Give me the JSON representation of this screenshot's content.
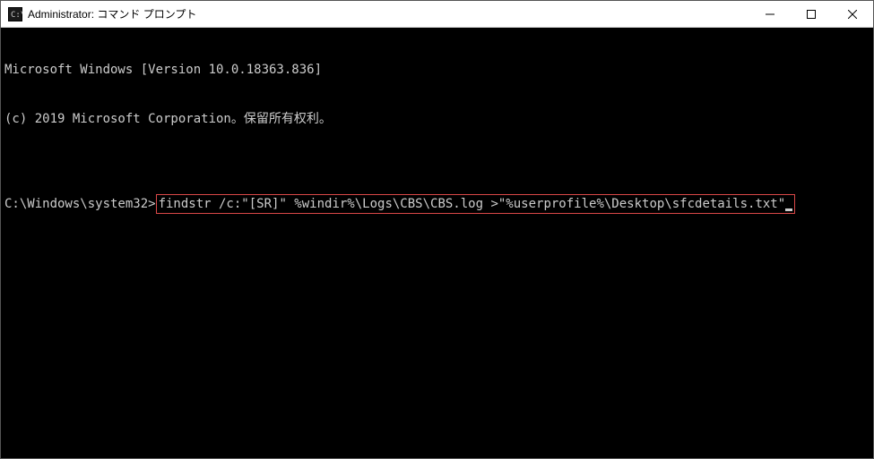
{
  "titlebar": {
    "title": "Administrator: コマンド プロンプト"
  },
  "terminal": {
    "line1": "Microsoft Windows [Version 10.0.18363.836]",
    "line2": "(c) 2019 Microsoft Corporation。保留所有权利。",
    "blank": "",
    "prompt": "C:\\Windows\\system32>",
    "command": "findstr /c:\"[SR]\" %windir%\\Logs\\CBS\\CBS.log >\"%userprofile%\\Desktop\\sfcdetails.txt\""
  }
}
